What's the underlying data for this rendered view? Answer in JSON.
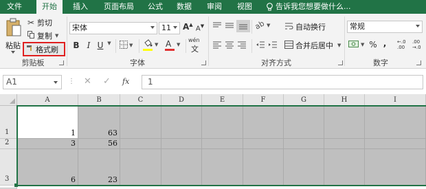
{
  "tabs": [
    "文件",
    "开始",
    "插入",
    "页面布局",
    "公式",
    "数据",
    "审阅",
    "视图"
  ],
  "active_tab": "开始",
  "tell_me": "告诉我您想要做什么...",
  "clipboard": {
    "paste": "粘贴",
    "cut": "剪切",
    "copy": "复制",
    "format_painter": "格式刷",
    "label": "剪贴板"
  },
  "font": {
    "name": "宋体",
    "size": "11",
    "bold": "B",
    "italic": "I",
    "underline": "U",
    "grow": "A",
    "shrink": "A",
    "color_a": "A",
    "phonetic": "wén",
    "label": "字体",
    "fill_color": "#ffff00",
    "font_color": "#e03030"
  },
  "alignment": {
    "wrap": "自动换行",
    "merge": "合并后居中",
    "label": "对齐方式"
  },
  "number": {
    "format": "常规",
    "percent": "%",
    "comma": ",",
    "inc_dec": "←.0 .00",
    "dec_dec": ".00 →.0",
    "label": "数字"
  },
  "formula_bar": {
    "name_box": "A1",
    "fx": "fx",
    "value": "1"
  },
  "columns": [
    "A",
    "B",
    "C",
    "D",
    "E",
    "F",
    "G",
    "H",
    "I"
  ],
  "rows": [
    {
      "num": "1",
      "a": "1",
      "b": "63"
    },
    {
      "num": "2",
      "a": "3",
      "b": "56"
    },
    {
      "num": "3",
      "a": "6",
      "b": "23"
    }
  ],
  "colors": {
    "brand": "#217346",
    "highlight_box": "#e02020",
    "selection_fill": "#bfbfbf"
  }
}
